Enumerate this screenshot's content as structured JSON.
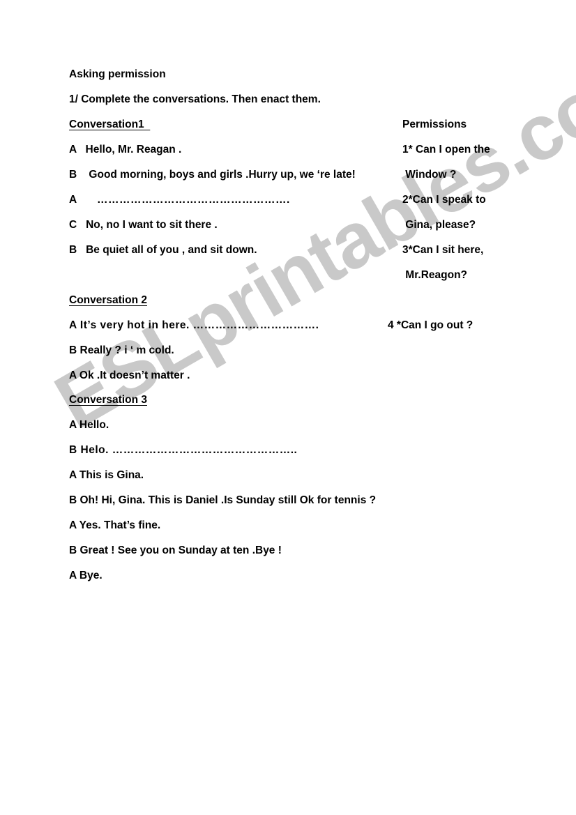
{
  "document": {
    "title": "Asking permission",
    "instruction": "1/ Complete the conversations. Then enact them.",
    "watermark": "ESLprintables.com",
    "watermark_color": "#c9c9c9",
    "page_background": "#ffffff",
    "text_color": "#000000"
  },
  "permissions_column": {
    "heading": "Permissions",
    "items": [
      "1* Can I open the",
      "Window ?",
      "2*Can I speak to",
      "Gina, please?",
      "3*Can I sit here,",
      "Mr.Reagon?"
    ],
    "item_extra": "4 *Can I go out ?"
  },
  "conversations": [
    {
      "heading": "Conversation1",
      "lines": [
        {
          "speaker": "A",
          "text": "Hello, Mr. Reagan ."
        },
        {
          "speaker": "B",
          "text": " Good morning, boys and girls .Hurry up, we ‘re late!"
        },
        {
          "speaker": "A",
          "text": "     ……………………………………………."
        },
        {
          "speaker": "C",
          "text": "No, no I want to sit there ."
        },
        {
          "speaker": "B",
          "text": "Be quiet all of you , and sit down."
        }
      ]
    },
    {
      "heading": "Conversation 2",
      "lines": [
        {
          "speaker": "A",
          "text": "It’s very hot in here. ……………………………."
        },
        {
          "speaker": "B",
          "text": "Really ? i ‘ m cold."
        },
        {
          "speaker": "A",
          "text": "Ok .It doesn’t matter ."
        }
      ]
    },
    {
      "heading": "Conversation 3",
      "lines": [
        {
          "speaker": "A",
          "text": "Hello."
        },
        {
          "speaker": "B",
          "text": "Helo. ………………………………………….."
        },
        {
          "speaker": "A",
          "text": "This is Gina."
        },
        {
          "speaker": "B",
          "text": "Oh! Hi, Gina. This is Daniel .Is Sunday still Ok for tennis ?"
        },
        {
          "speaker": "A",
          "text": "Yes. That’s fine."
        },
        {
          "speaker": "B",
          "text": "Great ! See you on Sunday at ten .Bye !"
        },
        {
          "speaker": "A",
          "text": "Bye."
        }
      ]
    }
  ],
  "rendered_lines": {
    "title": "Asking permission",
    "instruction": "1/ Complete the conversations. Then enact them.",
    "conv1_heading": "Conversation1  ",
    "permissions_heading": "Permissions",
    "c1_l1": "A   Hello, Mr. Reagan .",
    "p_l1": "1* Can I open the",
    "c1_l2": "B    Good morning, boys and girls .Hurry up, we ‘re late!",
    "p_l2": " Window ?",
    "c1_l3": "A      …………………………………………….",
    "p_l3": "2*Can I speak to",
    "c1_l4": "C   No, no I want to sit there .",
    "p_l4": " Gina, please?",
    "c1_l5": "B   Be quiet all of you , and sit down.",
    "p_l5": "3*Can I sit here,",
    "p_l6": " Mr.Reagon?",
    "conv2_heading": "Conversation 2",
    "c2_l1": "A It’s very hot in here. …………………………….",
    "p_l7": "4 *Can I go out ?",
    "c2_l2": "B Really ? i ‘ m cold.",
    "c2_l3": "A Ok .It doesn’t matter .",
    "conv3_heading": "Conversation 3",
    "c3_l1": "A Hello.",
    "c3_l2": "B Helo. …………………………………………..",
    "c3_l3": "A This is Gina.",
    "c3_l4": "B Oh! Hi, Gina. This is Daniel .Is Sunday still Ok for tennis ?",
    "c3_l5": "A Yes. That’s fine.",
    "c3_l6": "B Great ! See you on Sunday at ten .Bye !",
    "c3_l7": "A Bye."
  }
}
